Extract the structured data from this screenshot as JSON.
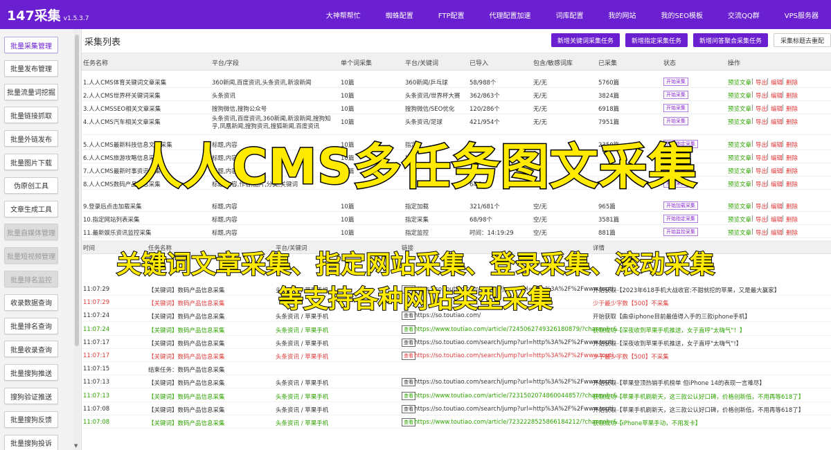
{
  "app": {
    "name": "147采集",
    "version": "v1.5.3.7"
  },
  "nav": [
    "大神帮帮忙",
    "蜘蛛配置",
    "FTP配置",
    "代理配置加速",
    "词库配置",
    "我的网站",
    "我的SEO模板",
    "交流QQ群",
    "VPS服务器"
  ],
  "sidebar": {
    "items": [
      {
        "label": "批量采集管理",
        "state": "active"
      },
      {
        "label": "批量发布管理",
        "state": "normal"
      },
      {
        "label": "批量流量词挖掘",
        "state": "normal"
      },
      {
        "label": "批量链接抓取",
        "state": "normal"
      },
      {
        "label": "批量外链发布",
        "state": "normal"
      },
      {
        "label": "批量图片下载",
        "state": "normal"
      },
      {
        "label": "伪原创工具",
        "state": "normal"
      },
      {
        "label": "文章生成工具",
        "state": "normal"
      },
      {
        "label": "批量自媒体管理",
        "state": "disabled"
      },
      {
        "label": "批量短视频管理",
        "state": "disabled"
      },
      {
        "label": "批量排名监控",
        "state": "disabled"
      },
      {
        "label": "收录数据查询",
        "state": "normal"
      },
      {
        "label": "批量排名查询",
        "state": "normal"
      },
      {
        "label": "批量收录查询",
        "state": "normal"
      },
      {
        "label": "批量搜狗推送",
        "state": "normal"
      },
      {
        "label": "搜狗验证推送",
        "state": "normal"
      },
      {
        "label": "批量搜狗反馈",
        "state": "normal"
      },
      {
        "label": "批量搜狗投诉",
        "state": "normal"
      }
    ]
  },
  "main": {
    "title": "采集列表",
    "buttons": [
      "新增关键词采集任务",
      "新增指定采集任务",
      "新增问答聚合采集任务",
      "采集标题去重配"
    ],
    "table": {
      "headers": [
        "任务名称",
        "平台/字段",
        "单个词采集",
        "平台/关键词",
        "已导入",
        "包含/敏感词库",
        "已采集",
        "状态",
        "操作"
      ],
      "rows": [
        {
          "name": "1.人人CMS体育关键词文章采集",
          "field": "360新闻,百度资讯,头条资讯,新浪新闻",
          "per": "10篇",
          "kw": "360新闻/乒乓球",
          "imp": "58/988个",
          "lib": "无/无",
          "got": "5760篇",
          "status": "开始采集"
        },
        {
          "name": "2.人人CMS世界杯关键词采集",
          "field": "头条资讯",
          "per": "10篇",
          "kw": "头条资讯/世界杯大赛",
          "imp": "362/863个",
          "lib": "无/无",
          "got": "3824篇",
          "status": "开始采集"
        },
        {
          "name": "3.人人CMSSEO相关文章采集",
          "field": "搜狗微信,搜狗公众号",
          "per": "10篇",
          "kw": "搜狗微信/SEO优化",
          "imp": "120/286个",
          "lib": "无/无",
          "got": "6918篇",
          "status": "开始采集"
        },
        {
          "name": "4.人人CMS汽车相关文章采集",
          "field": "头条资讯,百度资讯,360新闻,新浪新闻,搜狗知乎,凤凰新闻,搜狗资讯,搜狐新闻,百度资讯",
          "per": "10篇",
          "kw": "头条资讯/足球",
          "imp": "421/954个",
          "lib": "无/无",
          "got": "7951篇",
          "status": "开始采集"
        },
        {
          "name": "5.人人CMS最新科技信息文章采集",
          "field": "标题,内容",
          "per": "10篇",
          "kw": "指定",
          "imp": "1",
          "lib": "",
          "got": "2350篇",
          "status": "开始指定采集"
        },
        {
          "name": "6.人人CMS旅游攻略信息采集",
          "field": "标题,内容",
          "per": "10篇",
          "kw": "指定",
          "imp": "",
          "lib": "",
          "got": "",
          "status": "开始采集"
        },
        {
          "name": "7.人人CMS最新时事资讯采集",
          "field": "标题,内容",
          "per": "10篇",
          "kw": "",
          "imp": "",
          "lib": "",
          "got": "",
          "status": "开始采集"
        },
        {
          "name": "8.人人CMS数码产品信息采集",
          "field": "标题,内容,作者,图片,分类,关键词",
          "per": "",
          "kw": "",
          "imp": "64个",
          "lib": "",
          "got": "",
          "status": "开始采集"
        },
        {
          "name": "9.登录后点击加载采集",
          "field": "标题,内容",
          "per": "10篇",
          "kw": "指定加载",
          "imp": "321/681个",
          "lib": "空/无",
          "got": "965篇",
          "status": "开始加载采集"
        },
        {
          "name": "10.指定网站列表采集",
          "field": "标题,内容",
          "per": "10篇",
          "kw": "指定采集",
          "imp": "68/98个",
          "lib": "空/无",
          "got": "3581篇",
          "status": "开始指定采集"
        },
        {
          "name": "11.最新娱乐资讯监控采集",
          "field": "标题,内容",
          "per": "10篇",
          "kw": "指定监控",
          "imp": "时间：14:19:29",
          "lib": "空/无",
          "got": "881篇",
          "status": "开始监控采集"
        }
      ],
      "ops": [
        "预览文章",
        "导出",
        "编辑",
        "删除"
      ]
    },
    "log": {
      "headers": [
        "时间",
        "任务名称",
        "平台/关键词",
        "链接",
        "详情"
      ],
      "rows": [
        {
          "time": "11:07:29",
          "cls": "normal",
          "task": "【关键词】数码产品信息采集",
          "kw": "头条资讯 / 苹果手机",
          "btn": "查看",
          "url": "https://so.toutiao.com/search/jump?url=http%3A%2F%2Fwww.touti...",
          "detail": "开始获取【2023年618手机大战收官:不甜就挖的苹果，又是最大赢家】"
        },
        {
          "time": "11:07:29",
          "cls": "red",
          "task": "【关键词】数码产品信息采集",
          "kw": "",
          "btn": "",
          "url": "",
          "detail": "少于最少字数【500】不采集"
        },
        {
          "time": "11:07:24",
          "cls": "normal",
          "task": "【关键词】数码产品信息采集",
          "kw": "头条资讯 / 苹果手机",
          "btn": "查看",
          "url": "https://so.toutiao.com/",
          "detail": "开始获取【曲卓iphone目前最值得入手的三款iphone手机】"
        },
        {
          "time": "11:07:24",
          "cls": "green",
          "task": "【关键词】数码产品信息采集",
          "kw": "头条资讯 / 苹果手机",
          "btn": "查看",
          "url": "https://www.toutiao.com/article/7245062749326180879/?channel=&...",
          "detail": "获取成功【深夜收到苹果手机推送，女子直呼\"太嗨气\"！】"
        },
        {
          "time": "11:07:17",
          "cls": "normal",
          "task": "【关键词】数码产品信息采集",
          "kw": "头条资讯 / 苹果手机",
          "btn": "查看",
          "url": "https://so.toutiao.com/search/jump?url=http%3A%2F%2Fwww.touti...",
          "detail": "开始获取【深夜收到苹果手机推送，女子直呼\"太嗨气\"!】"
        },
        {
          "time": "11:07:17",
          "cls": "red",
          "task": "【关键词】数码产品信息采集",
          "kw": "头条资讯 / 苹果手机",
          "btn": "查看",
          "url": "https://so.toutiao.com/search/jump?url=http%3A%2F%2Fwww.touti...",
          "detail": "少于最少字数【500】不采集"
        },
        {
          "time": "11:07:15",
          "cls": "normal",
          "task": "结束任务：数码产品信息采集",
          "kw": "",
          "btn": "",
          "url": "",
          "detail": ""
        },
        {
          "time": "11:07:13",
          "cls": "normal",
          "task": "【关键词】数码产品信息采集",
          "kw": "头条资讯 / 苹果手机",
          "btn": "查看",
          "url": "https://so.toutiao.com/search/jump?url=http%3A%2F%2Fwww.touti...",
          "detail": "开始获取【苹果登顶热销手机榜单 但iPhone 14的表现一言难尽】"
        },
        {
          "time": "11:07:13",
          "cls": "green",
          "task": "【关键词】数码产品信息采集",
          "kw": "头条资讯 / 苹果手机",
          "btn": "查看",
          "url": "https://www.toutiao.com/article/7231502074860044857/?channel=&...",
          "detail": "获取成功【苹果手机刷新天，这三款公认好口碑，价格创新低，不用再等618了】"
        },
        {
          "time": "11:07:08",
          "cls": "normal",
          "task": "【关键词】数码产品信息采集",
          "kw": "头条资讯 / 苹果手机",
          "btn": "查看",
          "url": "https://so.toutiao.com/search/jump?url=http%3A%2F%2Fwww.touti...",
          "detail": "开始获取【苹果手机刷新天，这三款公认好口碑，价格创新低，不用再等618了】"
        },
        {
          "time": "11:07:08",
          "cls": "green",
          "task": "【关键词】数码产品信息采集",
          "kw": "头条资讯 / 苹果手机",
          "btn": "查看",
          "url": "https://www.toutiao.com/article/7232228525866184212/?channel=&...",
          "detail": "获取成功【iPhone苹果手动，不用发卡】"
        }
      ]
    }
  },
  "overlay": {
    "headline": "人人CMS多任务图文采集",
    "sub1": "关键词文章采集、指定网站采集、登录采集、滚动采集",
    "sub2": "等支持各种网站类型采集"
  },
  "colors": {
    "brand": "#6a1fd1",
    "success": "#2ea300",
    "danger": "#e03a3a",
    "overlay_text": "#ffea00"
  }
}
